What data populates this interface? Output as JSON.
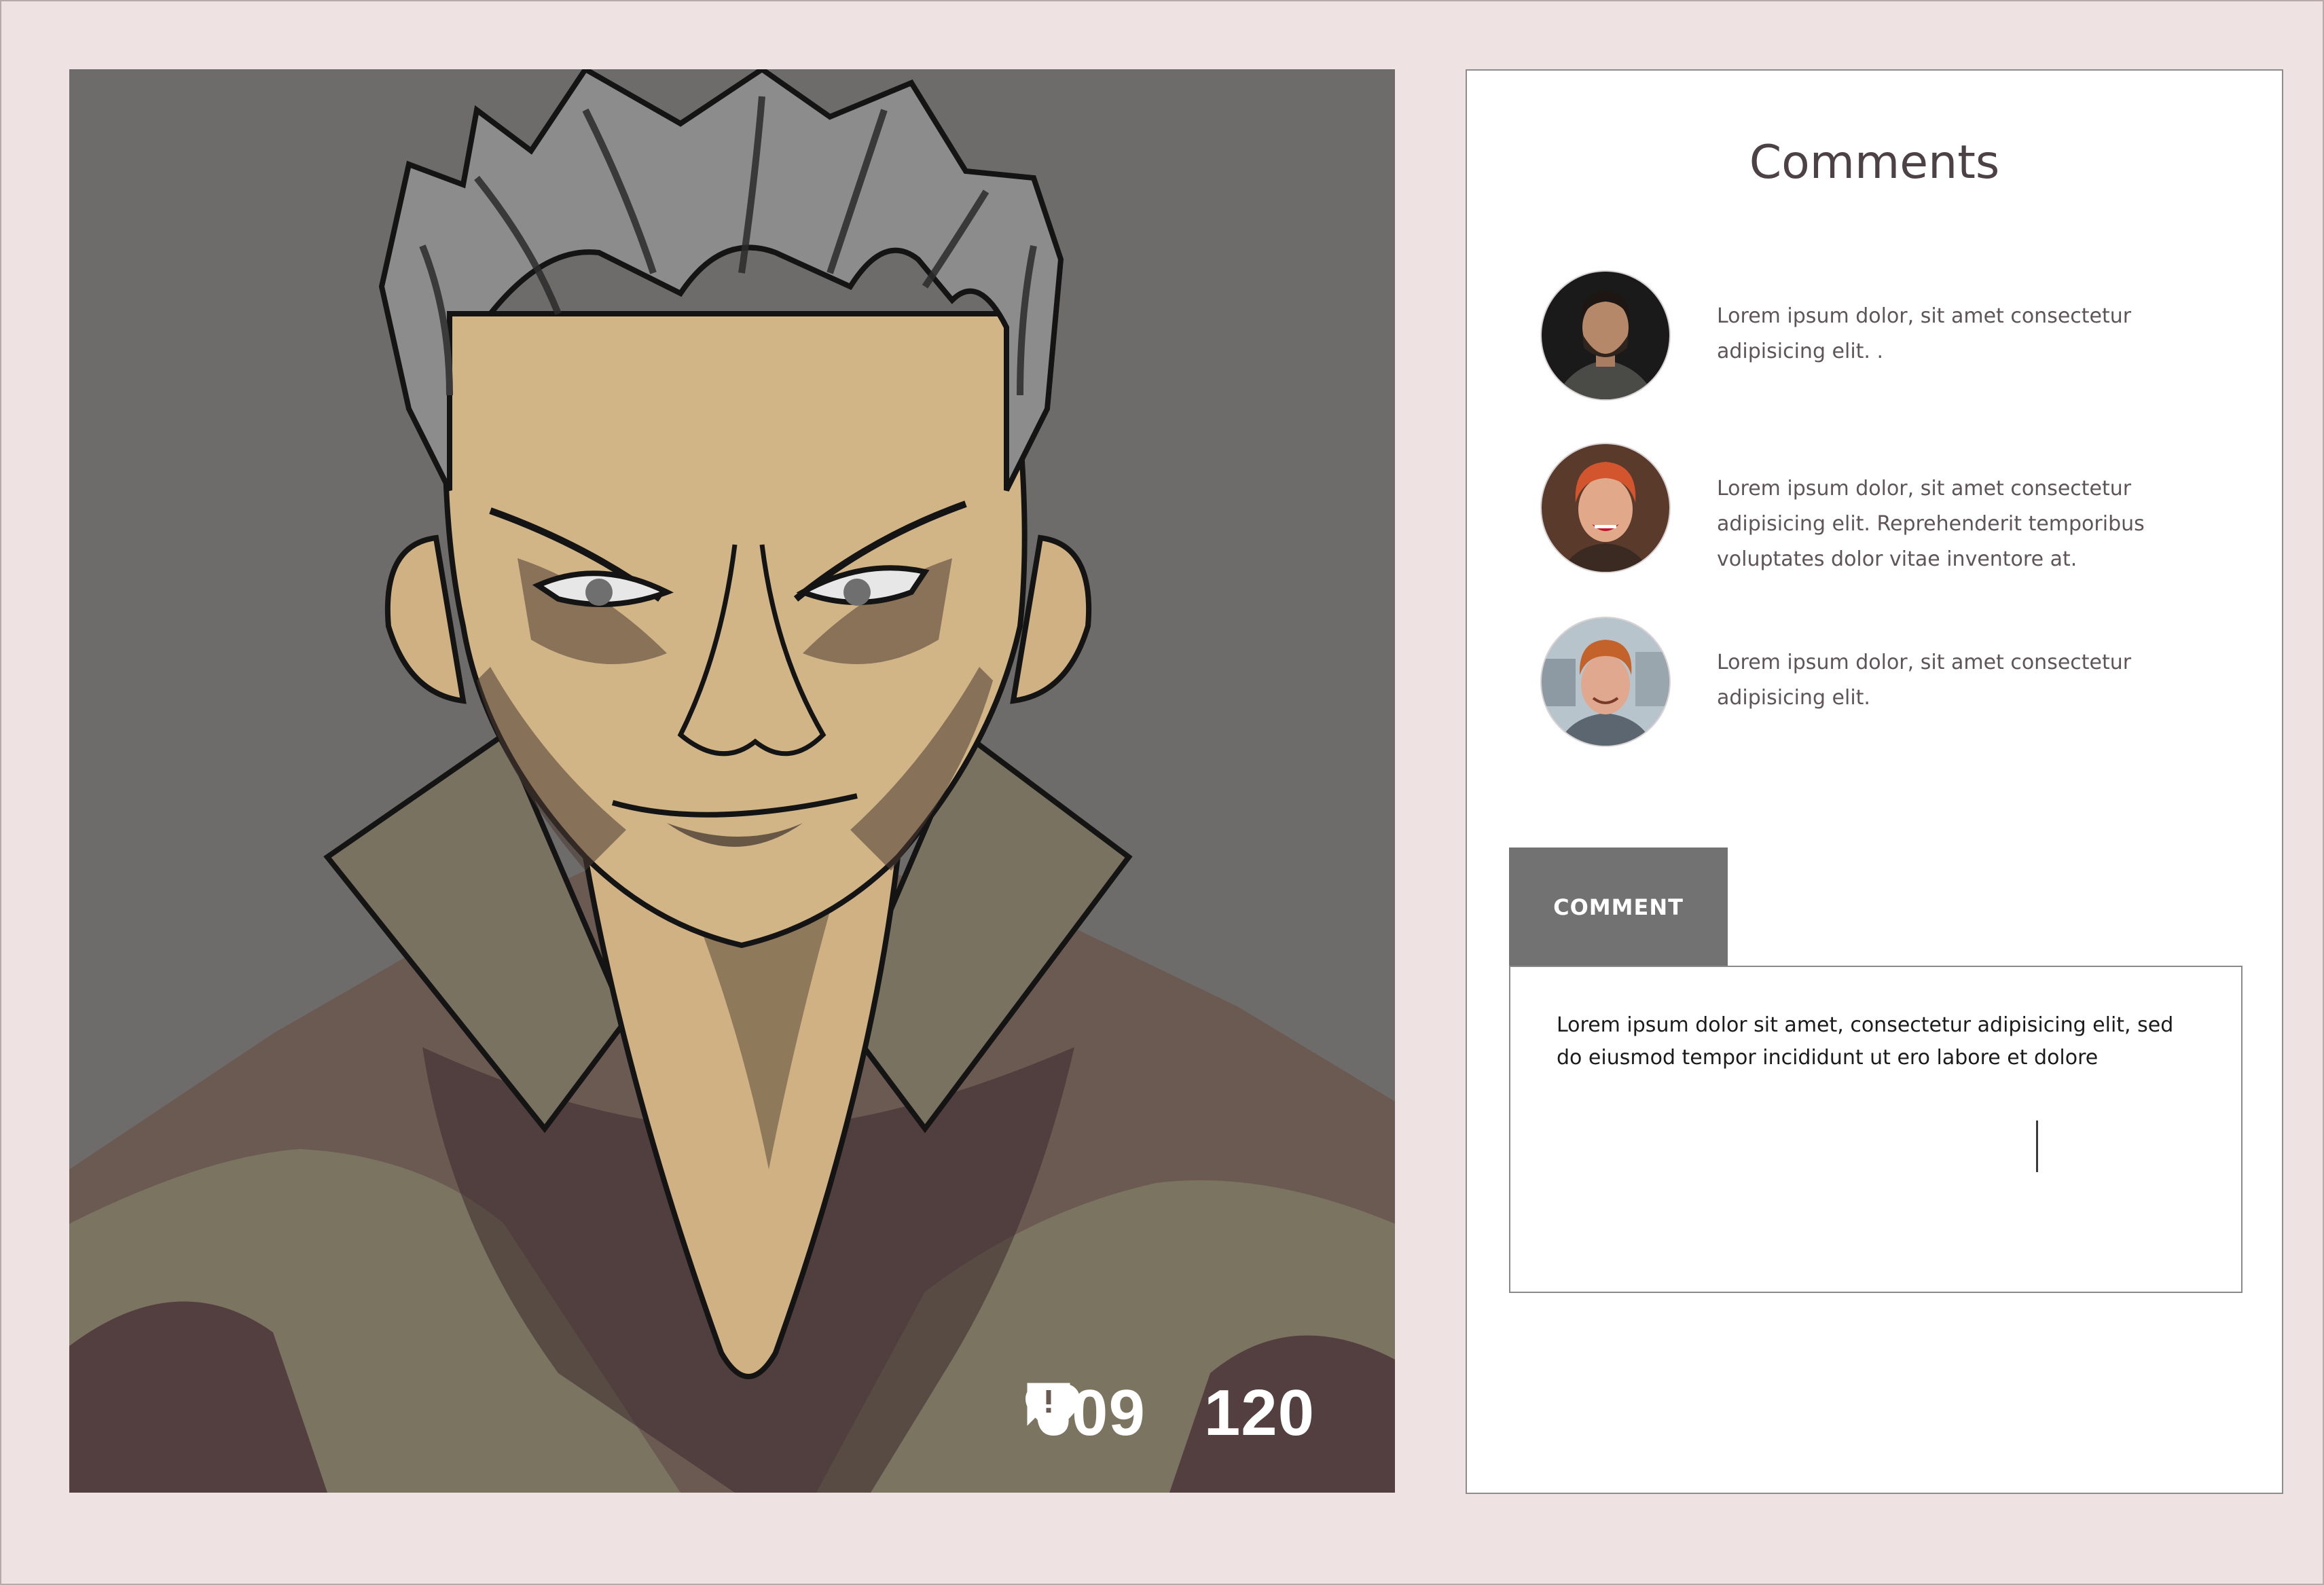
{
  "post": {
    "likes_count": "609",
    "comments_count": "120",
    "like_icon": "heart-icon",
    "comment_icon": "comment-alert-icon"
  },
  "comments_panel": {
    "title": "Comments",
    "comments": [
      {
        "avatar": "man-beard-avatar",
        "text": "Lorem ipsum dolor, sit amet consectetur adipisicing elit. ."
      },
      {
        "avatar": "red-hair-woman-avatar",
        "text": "Lorem ipsum dolor, sit amet consectetur adipisicing elit. Reprehenderit temporibus voluptates dolor vitae inventore at."
      },
      {
        "avatar": "ginger-man-avatar",
        "text": "Lorem ipsum dolor, sit amet consectetur adipisicing elit."
      }
    ],
    "compose": {
      "tab_label": "COMMENT",
      "value": "Lorem ipsum dolor sit amet, consectetur adipisicing elit, sed do eiusmod tempor incididunt ut ero labore et dolore"
    }
  },
  "colors": {
    "background": "#efe2e3",
    "tab": "#727272",
    "art_background": "#6e6c6a"
  }
}
